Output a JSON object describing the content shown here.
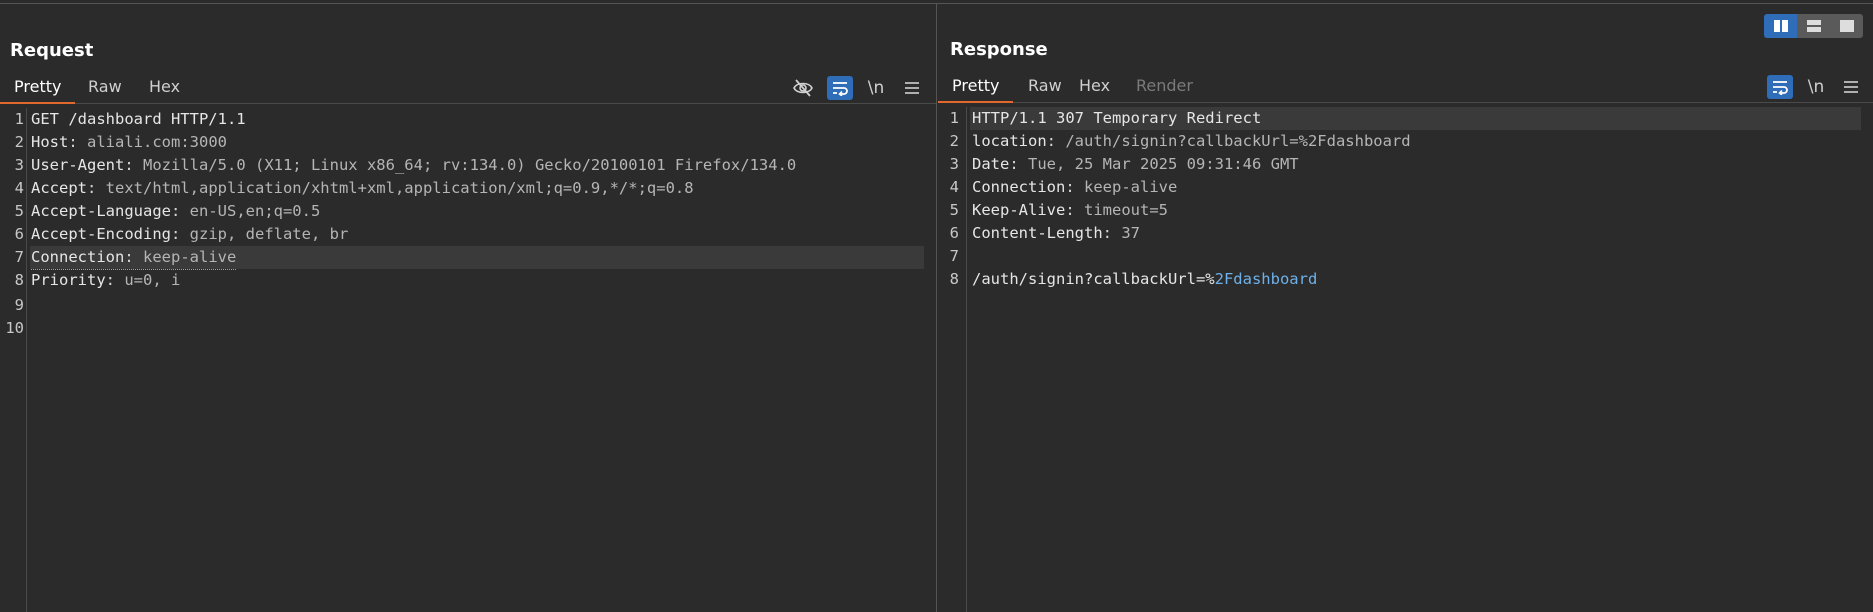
{
  "request": {
    "title": "Request",
    "tabs": [
      "Pretty",
      "Raw",
      "Hex"
    ],
    "active_tab": "Pretty",
    "tools": {
      "hide": "eye-off-icon",
      "wrap": "wrap-icon",
      "newline": "\\n",
      "menu": "menu-icon"
    },
    "lines": [
      {
        "n": "1",
        "h": "GET /dashboard HTTP/1.1",
        "v": ""
      },
      {
        "n": "2",
        "h": "Host",
        "v": " aliali.com:3000"
      },
      {
        "n": "3",
        "h": "User-Agent",
        "v": " Mozilla/5.0 (X11; Linux x86_64; rv:134.0) Gecko/20100101 Firefox/134.0"
      },
      {
        "n": "4",
        "h": "Accept",
        "v": " text/html,application/xhtml+xml,application/xml;q=0.9,*/*;q=0.8"
      },
      {
        "n": "5",
        "h": "Accept-Language",
        "v": " en-US,en;q=0.5"
      },
      {
        "n": "6",
        "h": "Accept-Encoding",
        "v": " gzip, deflate, br"
      },
      {
        "n": "7",
        "h": "Connection",
        "v": " keep-alive"
      },
      {
        "n": "8",
        "h": "Priority",
        "v": " u=0, i"
      },
      {
        "n": "9",
        "h": "",
        "v": ""
      },
      {
        "n": "10",
        "h": "",
        "v": ""
      }
    ]
  },
  "response": {
    "title": "Response",
    "tabs": [
      "Pretty",
      "Raw",
      "Hex",
      "Render"
    ],
    "active_tab": "Pretty",
    "tools": {
      "wrap": "wrap-icon",
      "newline": "\\n",
      "menu": "menu-icon"
    },
    "lines": [
      {
        "n": "1",
        "h": "HTTP/1.1 307 Temporary Redirect",
        "v": ""
      },
      {
        "n": "2",
        "h": "location",
        "v": " /auth/signin?callbackUrl=%2Fdashboard"
      },
      {
        "n": "3",
        "h": "Date",
        "v": " Tue, 25 Mar 2025 09:31:46 GMT"
      },
      {
        "n": "4",
        "h": "Connection",
        "v": " keep-alive"
      },
      {
        "n": "5",
        "h": "Keep-Alive",
        "v": " timeout=5"
      },
      {
        "n": "6",
        "h": "Content-Length",
        "v": " 37"
      },
      {
        "n": "7",
        "h": "",
        "v": ""
      },
      {
        "n": "8",
        "h": "/auth/signin?callbackUrl=%",
        "v": "2Fdashboard"
      }
    ]
  },
  "layout_buttons": [
    "split-horizontal-icon",
    "split-vertical-icon",
    "single-pane-icon"
  ],
  "colors": {
    "accent": "#2f6db8",
    "tab_underline": "#e06a2e",
    "background": "#2b2b2b"
  }
}
